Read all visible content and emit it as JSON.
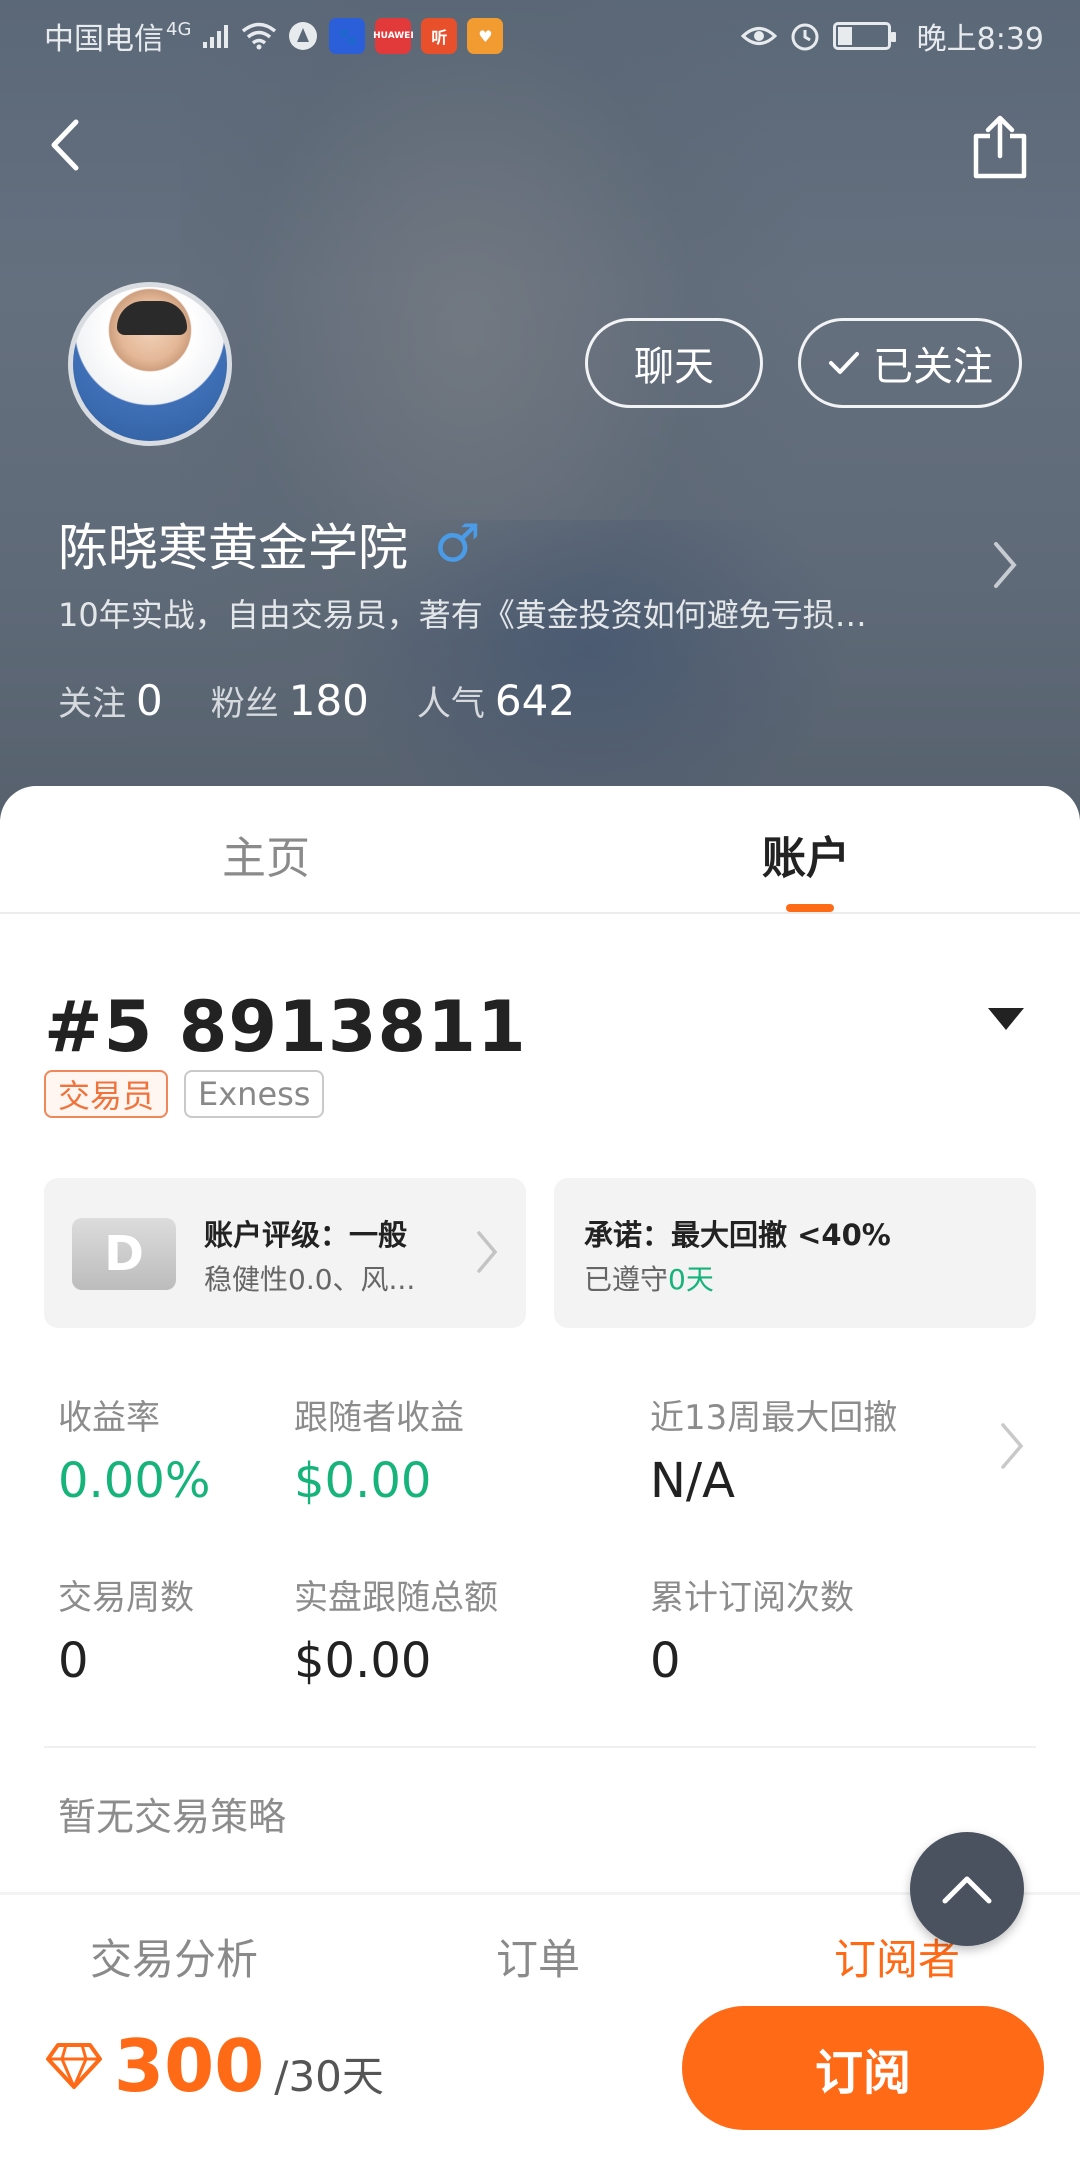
{
  "status_bar": {
    "carrier": "中国电信",
    "network": "4G",
    "time": "晚上8:39",
    "app_chips": [
      {
        "name": "baidu-app-icon",
        "label": "",
        "color": "#2b5fd9"
      },
      {
        "name": "huawei-app-icon",
        "label": "HUAWEI",
        "color": "#e23a3a"
      },
      {
        "name": "listen-app-icon",
        "label": "听",
        "color": "#e8502b"
      },
      {
        "name": "shield-app-icon",
        "label": "",
        "color": "#f29b30"
      }
    ]
  },
  "header": {
    "back_icon": "chevron-left-icon",
    "share_icon": "share-icon",
    "chat_label": "聊天",
    "follow_label": "已关注",
    "name": "陈晓寒黄金学院",
    "gender_icon": "♂",
    "bio": "10年实战，自由交易员，著有《黄金投资如何避免亏损…",
    "stats": [
      {
        "label": "关注",
        "value": "0"
      },
      {
        "label": "粉丝",
        "value": "180"
      },
      {
        "label": "人气",
        "value": "642"
      }
    ]
  },
  "tabs": {
    "home": "主页",
    "account": "账户"
  },
  "account": {
    "number": "#5 8913811",
    "tag_trader": "交易员",
    "tag_broker": "Exness",
    "rating_card": {
      "grade": "D",
      "title": "账户评级：一般",
      "subtitle": "稳健性0.0、风..."
    },
    "promise_card": {
      "title": "承诺：最大回撤 <40%",
      "sub_prefix": "已遵守",
      "sub_value": "0天"
    },
    "metrics": [
      {
        "label": "收益率",
        "value": "0.00%"
      },
      {
        "label": "跟随者收益",
        "value": "$0.00"
      },
      {
        "label": "近13周最大回撤",
        "value": "N/A"
      },
      {
        "label": "交易周数",
        "value": "0"
      },
      {
        "label": "实盘跟随总额",
        "value": "$0.00"
      },
      {
        "label": "累计订阅次数",
        "value": "0"
      }
    ],
    "no_strategy": "暂无交易策略"
  },
  "subtabs": {
    "analysis": "交易分析",
    "orders": "订单",
    "subscribers": "订阅者"
  },
  "footer": {
    "price": "300",
    "period": "/30天",
    "subscribe_label": "订阅"
  },
  "colors": {
    "accent": "#ff6a17",
    "positive": "#16b37a"
  }
}
